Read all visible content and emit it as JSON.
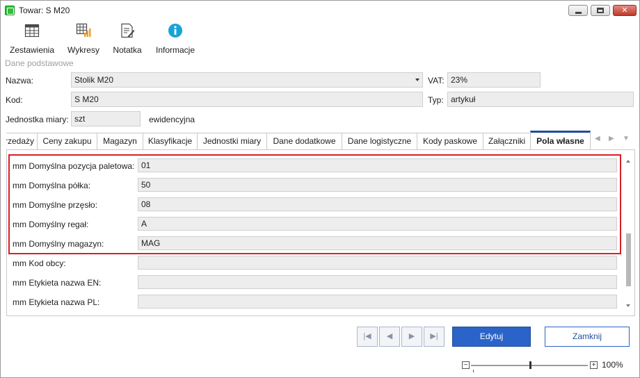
{
  "window": {
    "title": "Towar: S M20",
    "minimize_icon": "minimize-icon",
    "maximize_icon": "maximize-icon",
    "close_icon": "close-icon"
  },
  "toolbar": {
    "items": [
      {
        "label": "Zestawienia",
        "icon": "table-icon"
      },
      {
        "label": "Wykresy",
        "icon": "chart-icon"
      },
      {
        "label": "Notatka",
        "icon": "note-icon"
      },
      {
        "label": "Informacje",
        "icon": "info-icon"
      }
    ]
  },
  "basic": {
    "section_title": "Dane podstawowe",
    "name_label": "Nazwa:",
    "name_value": "Stolik M20",
    "vat_label": "VAT:",
    "vat_value": "23%",
    "code_label": "Kod:",
    "code_value": "S M20",
    "type_label": "Typ:",
    "type_value": "artykuł",
    "unit_label": "Jednostka miary:",
    "unit_value": "szt",
    "unit_note": "ewidencyjna"
  },
  "tabs": {
    "items": [
      {
        "label": "sprzedaży"
      },
      {
        "label": "Ceny zakupu"
      },
      {
        "label": "Magazyn"
      },
      {
        "label": "Klasyfikacje"
      },
      {
        "label": "Jednostki miary"
      },
      {
        "label": "Dane dodatkowe"
      },
      {
        "label": "Dane logistyczne"
      },
      {
        "label": "Kody paskowe"
      },
      {
        "label": "Załączniki"
      },
      {
        "label": "Pola własne"
      }
    ],
    "active": "Pola własne"
  },
  "custom_fields": {
    "rows": [
      {
        "label": "mm Domyślna pozycja paletowa:",
        "value": "01"
      },
      {
        "label": "mm Domyślna półka:",
        "value": "50"
      },
      {
        "label": "mm Domyślne przęsło:",
        "value": "08"
      },
      {
        "label": "mm Domyślny regał:",
        "value": "A"
      },
      {
        "label": "mm Domyślny magazyn:",
        "value": "MAG"
      },
      {
        "label": "mm Kod obcy:",
        "value": ""
      },
      {
        "label": "mm Etykieta nazwa EN:",
        "value": ""
      },
      {
        "label": "mm Etykieta nazwa PL:",
        "value": ""
      }
    ],
    "highlight_color": "#d81f26"
  },
  "actions": {
    "edit_label": "Edytuj",
    "close_label": "Zamknij",
    "nav_first_icon": "first-record-icon",
    "nav_prev_icon": "previous-record-icon",
    "nav_next_icon": "next-record-icon",
    "nav_last_icon": "last-record-icon"
  },
  "zoom": {
    "level": "100%",
    "minus": "−",
    "plus": "+"
  },
  "colors": {
    "accent": "#2b64c8",
    "active_tab_border": "#1f4e9c",
    "field_background": "#ededed"
  }
}
